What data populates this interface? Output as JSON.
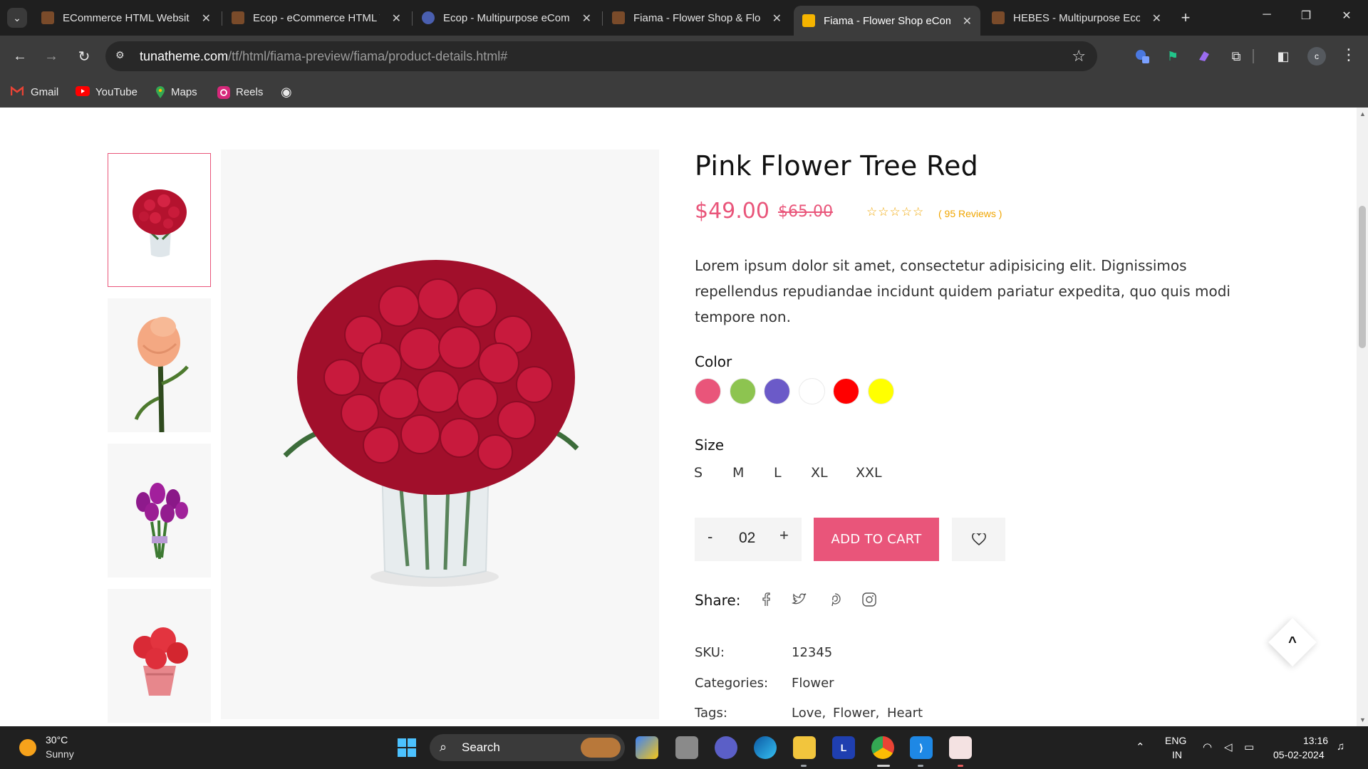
{
  "browser": {
    "tabs": [
      {
        "title": "ECommerce HTML Website",
        "favicon_color": "#7a4b2a"
      },
      {
        "title": "Ecop - eCommerce HTML T",
        "favicon_color": "#7a4b2a"
      },
      {
        "title": "Ecop - Multipurpose eCom",
        "favicon_color": "#4a5fb0"
      },
      {
        "title": "Fiama - Flower Shop & Flo",
        "favicon_color": "#7a4b2a"
      },
      {
        "title": "Fiama - Flower Shop eCom",
        "favicon_color": "#f5b400"
      },
      {
        "title": "HEBES - Multipurpose Eco",
        "favicon_color": "#7a4b2a"
      }
    ],
    "active_tab_index": 4,
    "url_host": "tunatheme.com",
    "url_path": "/tf/html/fiama-preview/fiama/product-details.html#",
    "profile_initial": "c",
    "bookmarks": [
      {
        "label": "Gmail",
        "icon": "gmail-icon"
      },
      {
        "label": "YouTube",
        "icon": "youtube-icon"
      },
      {
        "label": "Maps",
        "icon": "maps-icon"
      },
      {
        "label": "Reels",
        "icon": "instagram-icon"
      }
    ]
  },
  "product": {
    "title": "Pink Flower Tree Red",
    "price": "$49.00",
    "old_price": "$65.00",
    "rating": 0,
    "reviews": "( 95 Reviews )",
    "description": "Lorem ipsum dolor sit amet, consectetur adipisicing elit. Dignissimos repellendus repudiandae incidunt quidem pariatur expedita, quo quis modi tempore non.",
    "color_label": "Color",
    "colors": [
      "#e9557a",
      "#8dc450",
      "#6b5ac8",
      "#ffffff",
      "#ff0000",
      "#ffff00"
    ],
    "size_label": "Size",
    "sizes": [
      "S",
      "M",
      "L",
      "XL",
      "XXL"
    ],
    "quantity": "02",
    "qty_minus": "-",
    "qty_plus": "+",
    "add_to_cart": "ADD TO CART",
    "share_label": "Share:",
    "sku_label": "SKU:",
    "sku": "12345",
    "categories_label": "Categories:",
    "categories": "Flower",
    "tags_label": "Tags:",
    "tags": [
      "Love,",
      "Flower,",
      "Heart"
    ],
    "accent": "#e9557a"
  },
  "taskbar": {
    "temperature": "30°C",
    "condition": "Sunny",
    "search": "Search",
    "lang_top": "ENG",
    "lang_bottom": "IN",
    "time": "13:16",
    "date": "05-02-2024"
  }
}
